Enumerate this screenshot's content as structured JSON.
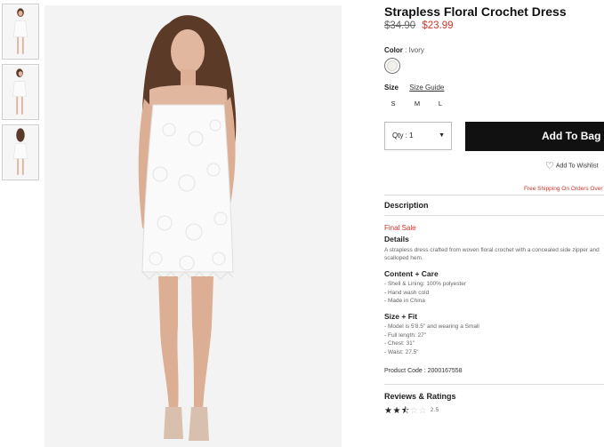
{
  "product": {
    "title": "Strapless Floral Crochet Dress",
    "price_original": "$34.90",
    "price_sale": "$23.99",
    "color_label": "Color",
    "color_value": ": Ivory",
    "size_label": "Size",
    "size_guide": "Size Guide",
    "sizes": [
      "S",
      "M",
      "L"
    ],
    "quantity": "Qty : 1",
    "add_to_bag": "Add To Bag",
    "wishlist": "Add To Wishlist",
    "shipping": "Free Shipping On Orders Over"
  },
  "description": {
    "header": "Description",
    "final_sale": "Final Sale",
    "details_header": "Details",
    "details_text": "A strapless dress crafted from woven floral crochet with a concealed side zipper and scalloped hem.",
    "content_header": "Content + Care",
    "content_lines": [
      "- Shell & Lining: 100% polyester",
      "- Hand wash cold",
      "- Made in China"
    ],
    "fit_header": "Size + Fit",
    "fit_lines": [
      "- Model is 5'8.5\" and wearing a Small",
      "- Full length: 27\"",
      "- Chest: 31\"",
      "- Waist: 27.5\""
    ],
    "product_code": "Product Code : 2000167558"
  },
  "reviews": {
    "header": "Reviews & Ratings",
    "rating_value": 2.5,
    "rating_text": "2.5"
  },
  "icons": {
    "heart": "heart-outline-icon",
    "dropdown": "caret-down-icon",
    "star": "star-icon"
  },
  "colors": {
    "sale_red": "#d0352a",
    "button_black": "#111111"
  }
}
